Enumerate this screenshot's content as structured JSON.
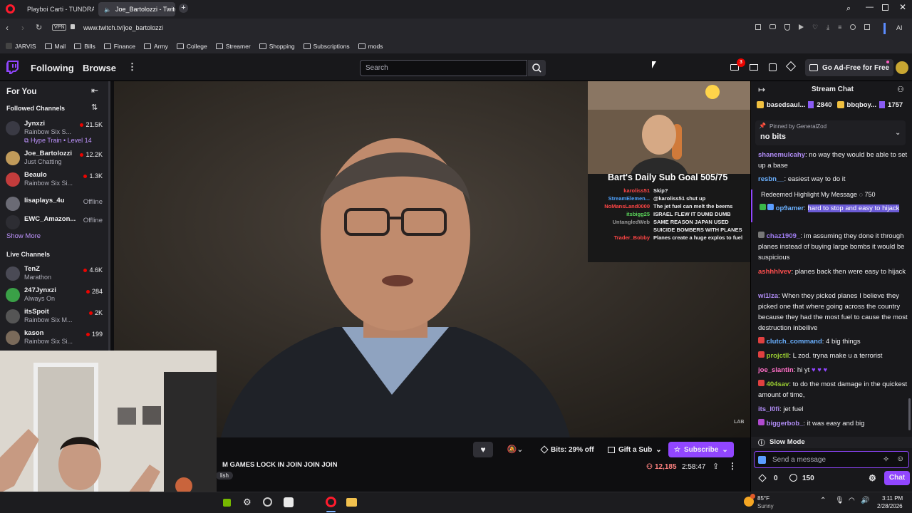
{
  "browser": {
    "tabs": [
      {
        "title": "Playboi Carti - TUNDRA/I..."
      },
      {
        "title": "Joe_Bartolozzi - Twitch"
      }
    ],
    "url": "www.twitch.tv/joe_bartolozzi",
    "vpn_label": "VPN",
    "ai_label": "AI",
    "bookmarks": [
      "JARVIS",
      "Mail",
      "Bills",
      "Finance",
      "Army",
      "College",
      "Streamer",
      "Shopping",
      "Subscriptions",
      "mods"
    ]
  },
  "twitch_nav": {
    "following": "Following",
    "browse": "Browse",
    "search_placeholder": "Search",
    "notif_count": "3",
    "ad_free": "Go Ad-Free for Free"
  },
  "sidebar": {
    "for_you": "For You",
    "followed_title": "Followed Channels",
    "followed": [
      {
        "name": "Jynxzi",
        "game": "Rainbow Six S...",
        "viewers": "21.5K",
        "extra": "Hype Train • Level 14"
      },
      {
        "name": "Joe_Bartolozzi",
        "game": "Just Chatting",
        "viewers": "12.2K"
      },
      {
        "name": "Beaulo",
        "game": "Rainbow Six Si...",
        "viewers": "1.3K"
      },
      {
        "name": "lisaplays_4u",
        "status": "Offline"
      },
      {
        "name": "EWC_Amazon...",
        "status": "Offline"
      }
    ],
    "show_more": "Show More",
    "live_title": "Live Channels",
    "live": [
      {
        "name": "TenZ",
        "game": "Marathon",
        "viewers": "4.6K"
      },
      {
        "name": "247Jynxzi",
        "game": "Always On",
        "viewers": "284"
      },
      {
        "name": "itsSpoit",
        "game": "Rainbow Six M...",
        "viewers": "2K"
      },
      {
        "name": "kason",
        "game": "Rainbow Six Si...",
        "viewers": "199"
      }
    ]
  },
  "overlay": {
    "sub_goal": "Bart's Daily Sub Goal 505/75",
    "chat": [
      {
        "user": "karoliss51",
        "msg": "Skip?"
      },
      {
        "user": "StreamElemen...",
        "msg": "@karoliss51 shut up"
      },
      {
        "user": "NoMansLand0000",
        "msg": "The jet fuel can melt the beems"
      },
      {
        "user": "itsbigg25",
        "msg": "ISRAEL FLEW IT DUMB DUMB"
      },
      {
        "user": "UntangledWeb",
        "msg": "SAME REASON JAPAN USED SUICIDE BOMBERS WITH PLANES"
      },
      {
        "user": "Trader_Bobby",
        "msg": "Planes create a huge explos to fuel"
      }
    ]
  },
  "below_video": {
    "title": "M GAMES LOCK IN JOIN JOIN JOIN",
    "tag": "lish",
    "bits": "Bits: 29% off",
    "gift": "Gift a Sub",
    "subscribe": "Subscribe",
    "viewers": "12,185",
    "uptime": "2:58:47"
  },
  "chat": {
    "title": "Stream Chat",
    "leaders": [
      {
        "name": "basedsaul...",
        "value": "2840"
      },
      {
        "name": "bbqboy...",
        "value": "1757"
      }
    ],
    "pinned_label": "Pinned by",
    "pinned_by": "GeneralZod",
    "pinned_msg": "no bits",
    "messages": [
      {
        "user": "shanemulcahy",
        "text": ": no way they would be able to set up a base",
        "color": "#b08cf5"
      },
      {
        "user": "resbn__",
        "text": ": easiest way to do it",
        "color": "#6ab0ff"
      },
      {
        "user": "op9amer",
        "text": ": ",
        "highlight": "hard to stop and easy to hijack",
        "color": "#6ab0ff"
      },
      {
        "user": "chaz1909_",
        "text": ": im assuming they done it through planes instead of buying large bombs it would be suspicious",
        "color": "#9e7cf0"
      },
      {
        "user": "ashhhlvev",
        "text": ": planes back then were easy to hijack",
        "color": "#ff4f4f"
      },
      {
        "user": "wi1lza",
        "text": ": When they picked planes I believe they picked one that where going across the country because they had the most fuel to cause the most destruction inbeilive",
        "color": "#b08cf5"
      },
      {
        "user": "clutch_command",
        "text": ": 4 big things",
        "color": "#6ab0ff"
      },
      {
        "user": "projctll",
        "text": ": L zod. tryna make u a terrorist",
        "color": "#9acd32"
      },
      {
        "user": "joe_slantin",
        "text": ": hi yt",
        "color": "#ff6ec7"
      },
      {
        "user": "404sav",
        "text": ": to do the most damage in the quickest amount of time,",
        "color": "#9acd32"
      },
      {
        "user": "its_l0fi",
        "text": ": jet fuel",
        "color": "#b08cf5"
      },
      {
        "user": "biggerbob_",
        "text": ": it was easy and big",
        "color": "#b08cf5"
      }
    ],
    "redeemed": "Redeemed Highlight My Message",
    "redeemed_cost": "750",
    "slow_mode": "Slow Mode",
    "input_placeholder": "Send a message",
    "bits_count": "0",
    "points": "150",
    "chat_button": "Chat"
  },
  "taskbar": {
    "temp": "85°F",
    "weather": "Sunny",
    "time": "3:11 PM",
    "date": "2/28/2026"
  }
}
